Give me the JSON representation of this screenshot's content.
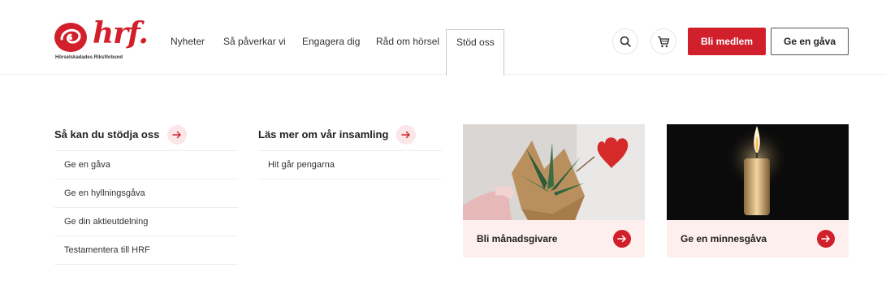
{
  "brand": {
    "wordmark": "hrf.",
    "tagline": "Hörselskadades Riksförbund",
    "accent_color": "#d1202b"
  },
  "nav": {
    "items": [
      "Nyheter",
      "Så påverkar vi",
      "Engagera dig",
      "Råd om hörsel"
    ],
    "active_item": "Stöd oss"
  },
  "header_actions": {
    "search_icon": "search-icon",
    "cart_icon": "cart-icon",
    "primary_label": "Bli medlem",
    "secondary_label": "Ge en gåva"
  },
  "menu": {
    "support": {
      "title": "Så kan du stödja oss",
      "links": [
        "Ge en gåva",
        "Ge en hyllningsgåva",
        "Ge din aktieutdelning",
        "Testamentera till HRF"
      ]
    },
    "fundraising": {
      "title": "Läs mer om vår insamling",
      "links": [
        "Hit går pengarna"
      ]
    },
    "cards": [
      {
        "label": "Bli månadsgivare",
        "image": "plant-with-heart-image"
      },
      {
        "label": "Ge en minnesgåva",
        "image": "candle-image"
      }
    ]
  }
}
